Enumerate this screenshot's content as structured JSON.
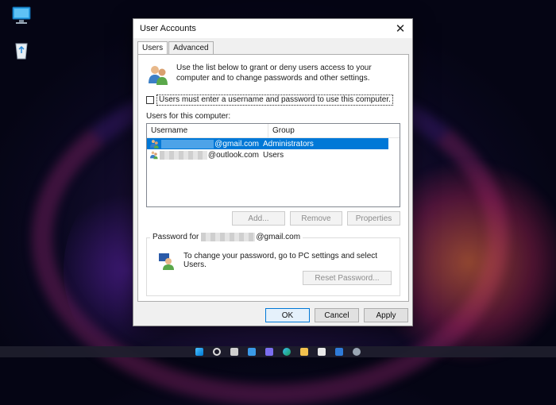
{
  "dialog": {
    "title": "User Accounts",
    "close_label": "✕",
    "tabs": [
      {
        "label": "Users",
        "active": true
      },
      {
        "label": "Advanced",
        "active": false
      }
    ],
    "intro_text": "Use the list below to grant or deny users access to your computer and to change passwords and other settings.",
    "checkbox_label": "Users must enter a username and password to use this computer.",
    "checkbox_checked": false,
    "users_label": "Users for this computer:",
    "list": {
      "columns": [
        "Username",
        "Group"
      ],
      "rows": [
        {
          "username": "@gmail.com",
          "group": "Administrators",
          "selected": true
        },
        {
          "username": "@outlook.com",
          "group": "Users",
          "selected": false
        }
      ]
    },
    "buttons": {
      "add": "Add...",
      "remove": "Remove",
      "properties": "Properties"
    },
    "password_group": {
      "legend_prefix": "Password for",
      "legend_suffix": "@gmail.com",
      "text": "To change your password, go to PC settings and select Users.",
      "reset_button": "Reset Password..."
    },
    "footer": {
      "ok": "OK",
      "cancel": "Cancel",
      "apply": "Apply"
    }
  },
  "taskbar": {
    "icons": [
      "windows-start-icon",
      "search-icon",
      "task-view-icon",
      "widgets-icon",
      "chat-icon",
      "edge-icon",
      "file-explorer-icon",
      "store-icon",
      "mail-icon",
      "settings-icon"
    ]
  },
  "colors": {
    "selection": "#0078d7",
    "dialog_bg": "#f0f0f0"
  }
}
